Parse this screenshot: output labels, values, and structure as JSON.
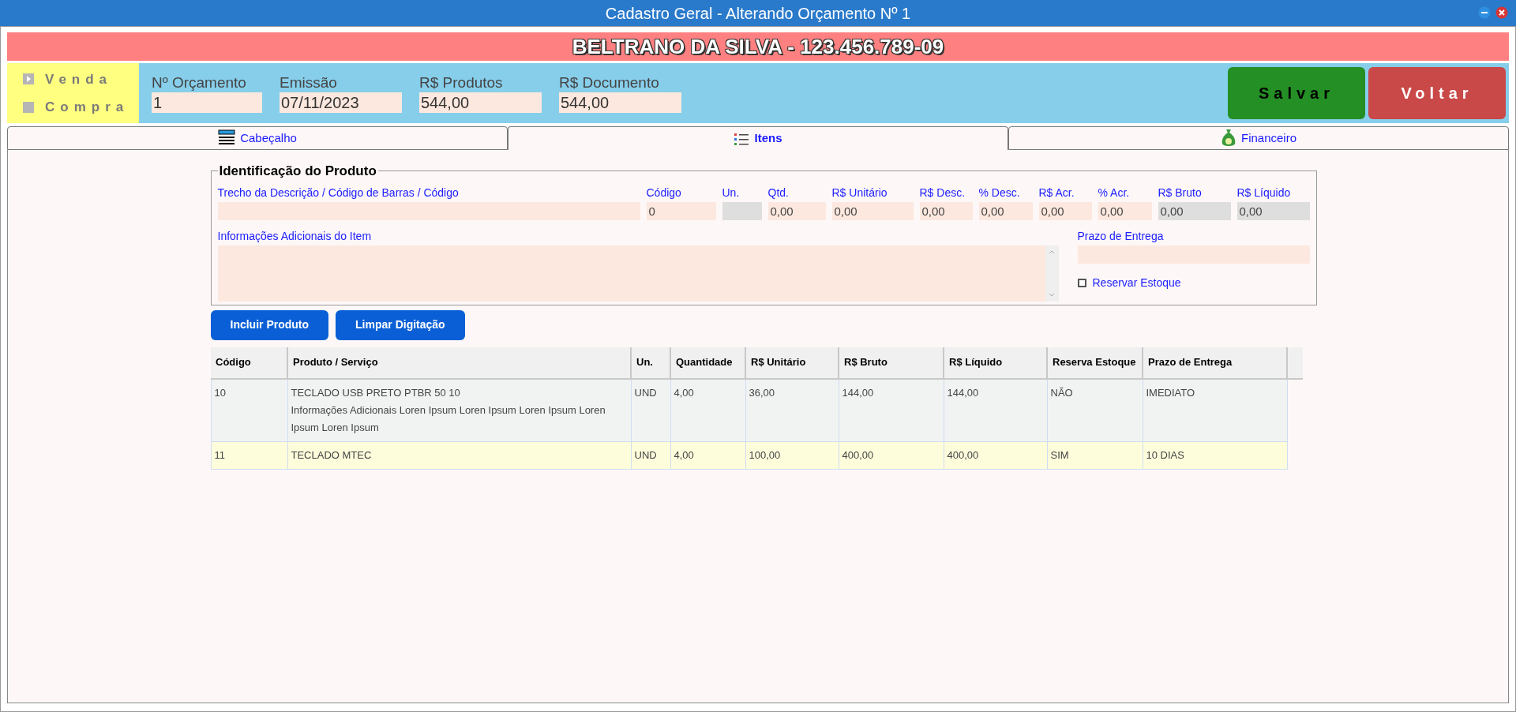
{
  "window": {
    "title": "Cadastro Geral - Alterando Orçamento Nº 1"
  },
  "customer_banner": "BELTRANO DA SILVA - 123.456.789-09",
  "operation": [
    {
      "label": "Venda",
      "selected": true
    },
    {
      "label": "Compra",
      "selected": false
    }
  ],
  "summary": [
    {
      "label": "Nº Orçamento",
      "value": "1"
    },
    {
      "label": "Emissão",
      "value": "07/11/2023"
    },
    {
      "label": "R$ Produtos",
      "value": "544,00"
    },
    {
      "label": "R$ Documento",
      "value": "544,00"
    }
  ],
  "actions": [
    {
      "label": "Salvar",
      "kind": "save"
    },
    {
      "label": "Voltar",
      "kind": "back"
    }
  ],
  "tabs": [
    {
      "label": "Cabeçalho",
      "selected": false
    },
    {
      "label": "Itens",
      "selected": true
    },
    {
      "label": "Financeiro",
      "selected": false
    }
  ],
  "product_form": {
    "title": "Identificação do Produto",
    "fields": [
      {
        "label": "Trecho da Descrição / Código de Barras / Código",
        "readonly": false
      },
      {
        "label": "Código",
        "value": "0",
        "readonly": false
      },
      {
        "label": "Un.",
        "readonly": true
      },
      {
        "label": "Qtd.",
        "value": "0,00",
        "readonly": false
      },
      {
        "label": "R$ Unitário",
        "value": "0,00",
        "readonly": false
      },
      {
        "label": "R$ Desc.",
        "value": "0,00",
        "readonly": false
      },
      {
        "label": "% Desc.",
        "value": "0,00",
        "readonly": false
      },
      {
        "label": "R$ Acr.",
        "value": "0,00",
        "readonly": false
      },
      {
        "label": "% Acr.",
        "value": "0,00",
        "readonly": false
      },
      {
        "label": "R$ Bruto",
        "value": "0,00",
        "readonly": true
      },
      {
        "label": "R$ Líquido",
        "value": "0,00",
        "readonly": true
      }
    ],
    "notes_label": "Informações Adicionais do Item",
    "delivery_label": "Prazo de Entrega",
    "reserve": {
      "label": "Reservar Estoque",
      "checked": false
    },
    "buttons": [
      "Incluir Produto",
      "Limpar Digitação"
    ]
  },
  "table": {
    "columns": [
      "Código",
      "Produto / Serviço",
      "Un.",
      "Quantidade",
      "R$ Unitário",
      "R$ Bruto",
      "R$ Líquido",
      "Reserva Estoque",
      "Prazo de Entrega"
    ],
    "rows": [
      {
        "selected": false,
        "cells": [
          "10",
          "TECLADO USB PRETO PTBR 50 10",
          "UND",
          "4,00",
          "36,00",
          "144,00",
          "144,00",
          "NÃO",
          "IMEDIATO"
        ],
        "details": "Informações Adicionais Loren Ipsum Loren Ipsum Loren Ipsum Loren Ipsum Loren Ipsum"
      },
      {
        "selected": true,
        "cells": [
          "11",
          "TECLADO MTEC",
          "UND",
          "4,00",
          "100,00",
          "400,00",
          "400,00",
          "SIM",
          "10 DIAS"
        ]
      }
    ]
  }
}
